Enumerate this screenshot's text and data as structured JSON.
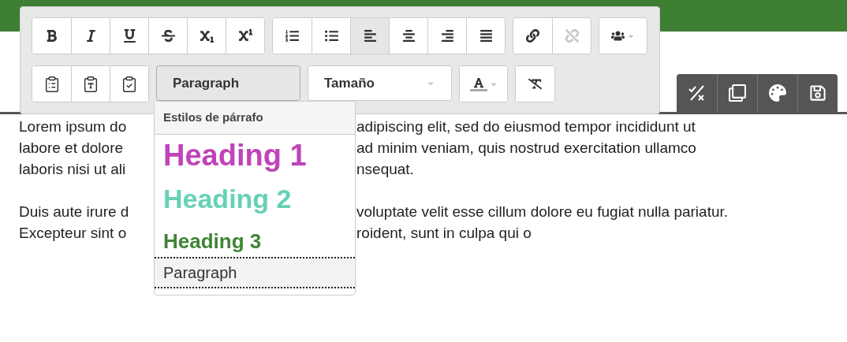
{
  "toolbar": {
    "rows": [
      {
        "groups": [
          {
            "buttons": [
              {
                "kind": "bold",
                "selected": false,
                "disabled": false
              },
              {
                "kind": "italic",
                "selected": false,
                "disabled": false
              },
              {
                "kind": "underline",
                "selected": false,
                "disabled": false
              },
              {
                "kind": "strike",
                "selected": false,
                "disabled": false
              },
              {
                "kind": "subscript",
                "selected": false,
                "disabled": false
              },
              {
                "kind": "superscript",
                "selected": false,
                "disabled": false
              }
            ]
          },
          {
            "buttons": [
              {
                "kind": "ordered-list",
                "selected": false,
                "disabled": false
              },
              {
                "kind": "bullet-list",
                "selected": false,
                "disabled": false
              },
              {
                "kind": "align-left",
                "selected": true,
                "disabled": false
              },
              {
                "kind": "align-center",
                "selected": false,
                "disabled": false
              },
              {
                "kind": "align-right",
                "selected": false,
                "disabled": false
              },
              {
                "kind": "justify",
                "selected": false,
                "disabled": false
              }
            ]
          },
          {
            "buttons": [
              {
                "kind": "link",
                "selected": false,
                "disabled": false
              },
              {
                "kind": "unlink",
                "selected": false,
                "disabled": true
              }
            ]
          },
          {
            "buttons": [
              {
                "kind": "users",
                "selected": false,
                "disabled": false,
                "caret": true
              }
            ]
          }
        ]
      },
      {
        "groups": [
          {
            "buttons": [
              {
                "kind": "paste",
                "selected": false,
                "disabled": false
              },
              {
                "kind": "paste-text",
                "selected": false,
                "disabled": false
              },
              {
                "kind": "paste-word",
                "selected": false,
                "disabled": false
              }
            ]
          },
          {
            "select": {
              "value": "Paragraph",
              "open": true
            }
          },
          {
            "select": {
              "value": "Tamaño",
              "open": false
            }
          },
          {
            "buttons": [
              {
                "kind": "font-color",
                "selected": false,
                "disabled": false,
                "caret": true
              }
            ]
          },
          {
            "buttons": [
              {
                "kind": "clear-format",
                "selected": false,
                "disabled": false
              }
            ]
          }
        ]
      }
    ]
  },
  "style_menu": {
    "title": "Estilos de párrafo",
    "items": [
      {
        "label": "Heading 1",
        "kind": "h1",
        "color": "#c044b9",
        "selected": false
      },
      {
        "label": "Heading 2",
        "kind": "h2",
        "color": "#66d1b6",
        "selected": false
      },
      {
        "label": "Heading 3",
        "kind": "h3",
        "color": "#3f8535",
        "selected": false
      },
      {
        "label": "Paragraph",
        "kind": "p",
        "selected": true
      }
    ]
  },
  "actions": [
    {
      "kind": "spellcheck"
    },
    {
      "kind": "duplicate"
    },
    {
      "kind": "palette"
    },
    {
      "kind": "save"
    }
  ],
  "content": {
    "paragraphs": [
      {
        "lines": [
          {
            "left": "Lorem ipsum do",
            "right": "adipiscing elit, sed do eiusmod tempor incididunt ut"
          },
          {
            "left": "labore et dolore",
            "right": "ad minim veniam, quis nostrud exercitation ullamco"
          },
          {
            "left": "laboris nisi ut ali",
            "right": "nsequat."
          }
        ]
      },
      {
        "lines": [
          {
            "left": "Duis aute irure d",
            "right": "voluptate velit esse cillum dolore eu fugiat nulla pariatur."
          },
          {
            "left": "Excepteur sint o",
            "right": "roident, sunt in culpa qui o"
          }
        ]
      }
    ]
  }
}
